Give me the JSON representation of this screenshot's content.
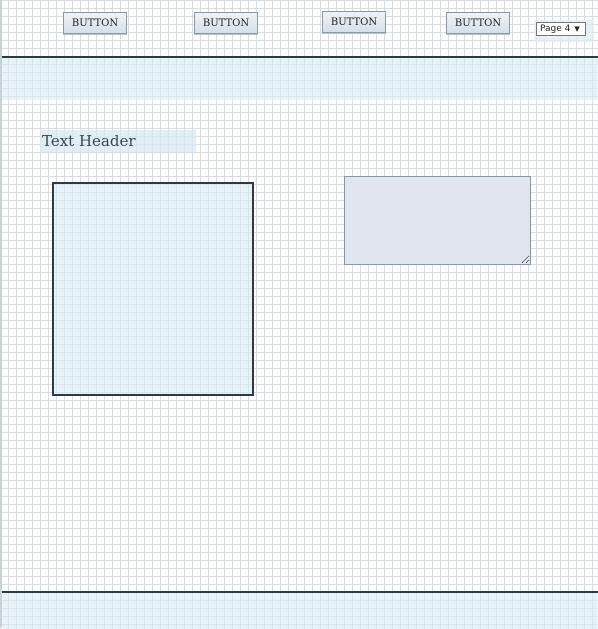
{
  "toolbar": {
    "buttons": [
      {
        "label": "BUTTON"
      },
      {
        "label": "BUTTON"
      },
      {
        "label": "BUTTON"
      },
      {
        "label": "BUTTON"
      }
    ],
    "page_select": {
      "value": "Page 4"
    }
  },
  "content": {
    "text_header": "Text Header",
    "textarea": {
      "value": ""
    }
  },
  "colors": {
    "band_fill": "#d6eaf2",
    "rule_line": "#2c3a44",
    "textarea_fill": "#e1e6ee",
    "grid_line": "#d7dde2"
  }
}
